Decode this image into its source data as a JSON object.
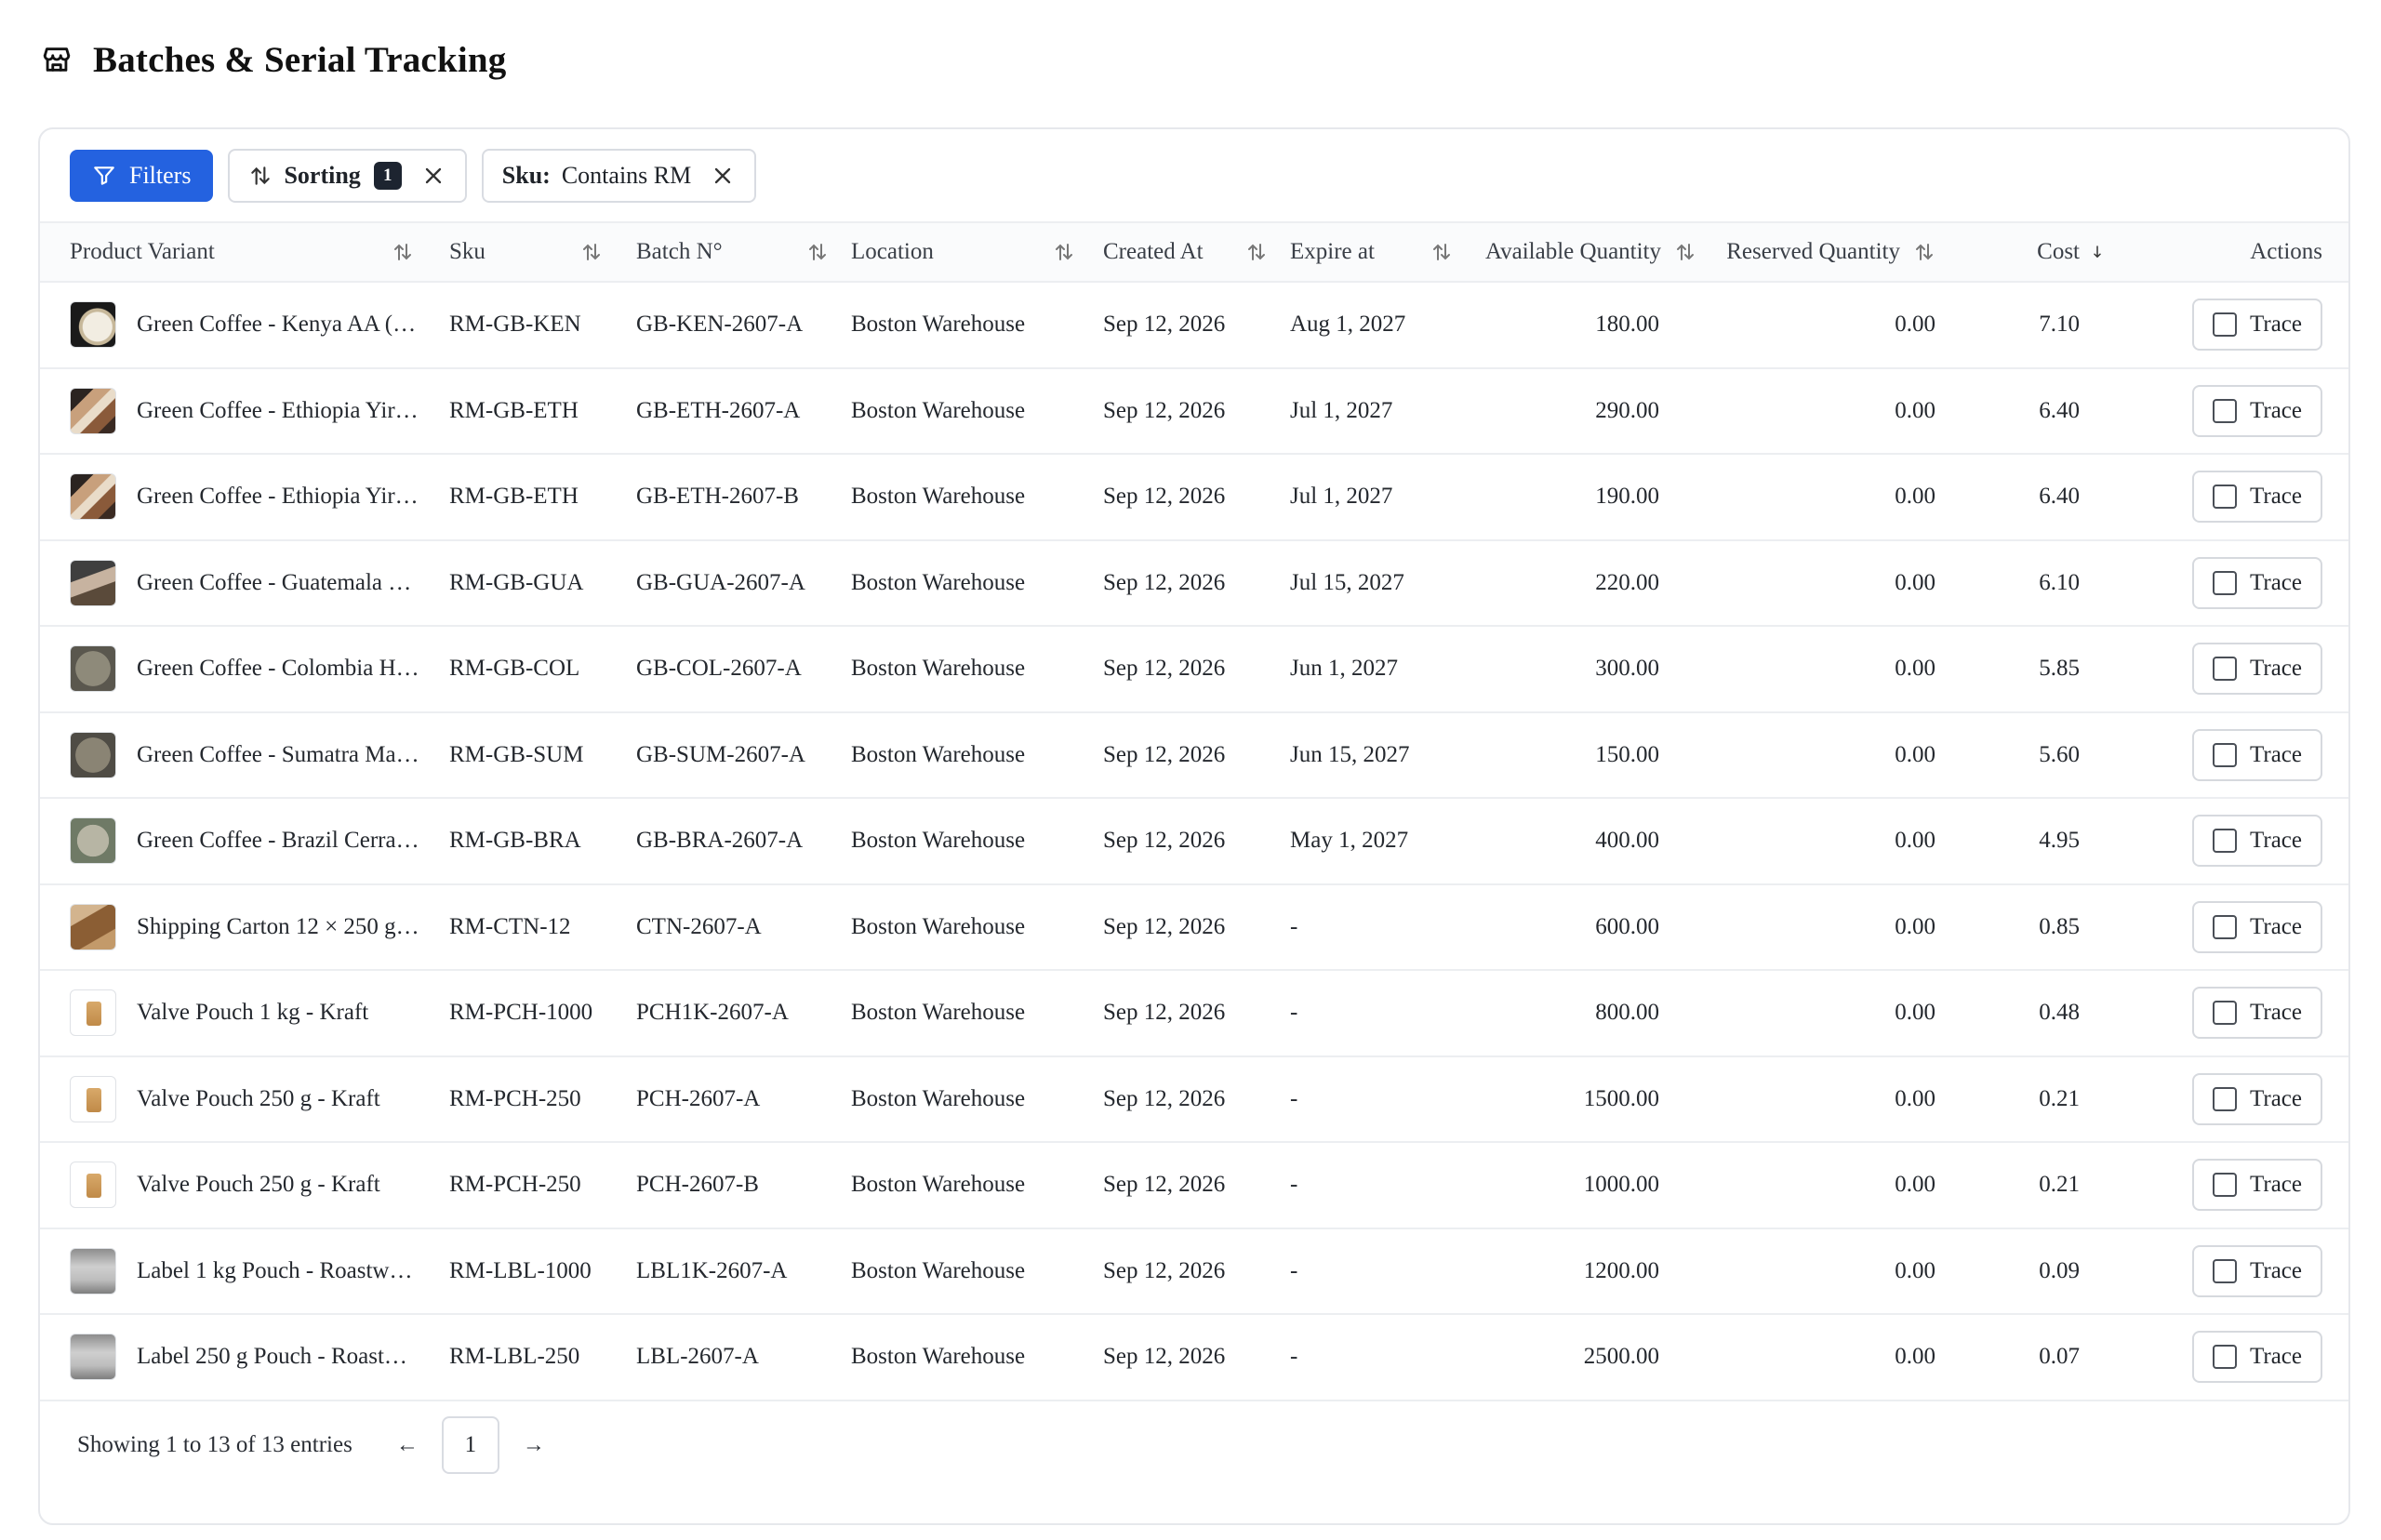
{
  "page": {
    "title": "Batches & Serial Tracking"
  },
  "toolbar": {
    "filters_label": "Filters",
    "sorting_label": "Sorting",
    "sorting_count": "1",
    "sku_chip_key": "Sku:",
    "sku_chip_value": "Contains RM"
  },
  "table": {
    "columns": [
      "Product Variant",
      "Sku",
      "Batch N°",
      "Location",
      "Created At",
      "Expire at",
      "Available Quantity",
      "Reserved Quantity",
      "Cost",
      "Actions"
    ],
    "cost_sort": "desc",
    "trace_label": "Trace",
    "rows": [
      {
        "variant": "Green Coffee - Kenya AA (…",
        "sku": "RM-GB-KEN",
        "batch": "GB-KEN-2607-A",
        "location": "Boston Warehouse",
        "created": "Sep 12, 2026",
        "expire": "Aug 1, 2027",
        "available": "180.00",
        "reserved": "0.00",
        "cost": "7.10",
        "thumb": "kenya"
      },
      {
        "variant": "Green Coffee - Ethiopia Yir…",
        "sku": "RM-GB-ETH",
        "batch": "GB-ETH-2607-A",
        "location": "Boston Warehouse",
        "created": "Sep 12, 2026",
        "expire": "Jul 1, 2027",
        "available": "290.00",
        "reserved": "0.00",
        "cost": "6.40",
        "thumb": "eth"
      },
      {
        "variant": "Green Coffee - Ethiopia Yir…",
        "sku": "RM-GB-ETH",
        "batch": "GB-ETH-2607-B",
        "location": "Boston Warehouse",
        "created": "Sep 12, 2026",
        "expire": "Jul 1, 2027",
        "available": "190.00",
        "reserved": "0.00",
        "cost": "6.40",
        "thumb": "eth"
      },
      {
        "variant": "Green Coffee - Guatemala …",
        "sku": "RM-GB-GUA",
        "batch": "GB-GUA-2607-A",
        "location": "Boston Warehouse",
        "created": "Sep 12, 2026",
        "expire": "Jul 15, 2027",
        "available": "220.00",
        "reserved": "0.00",
        "cost": "6.10",
        "thumb": "gua"
      },
      {
        "variant": "Green Coffee - Colombia H…",
        "sku": "RM-GB-COL",
        "batch": "GB-COL-2607-A",
        "location": "Boston Warehouse",
        "created": "Sep 12, 2026",
        "expire": "Jun 1, 2027",
        "available": "300.00",
        "reserved": "0.00",
        "cost": "5.85",
        "thumb": "col"
      },
      {
        "variant": "Green Coffee - Sumatra Ma…",
        "sku": "RM-GB-SUM",
        "batch": "GB-SUM-2607-A",
        "location": "Boston Warehouse",
        "created": "Sep 12, 2026",
        "expire": "Jun 15, 2027",
        "available": "150.00",
        "reserved": "0.00",
        "cost": "5.60",
        "thumb": "sum"
      },
      {
        "variant": "Green Coffee - Brazil Cerra…",
        "sku": "RM-GB-BRA",
        "batch": "GB-BRA-2607-A",
        "location": "Boston Warehouse",
        "created": "Sep 12, 2026",
        "expire": "May 1, 2027",
        "available": "400.00",
        "reserved": "0.00",
        "cost": "4.95",
        "thumb": "bra"
      },
      {
        "variant": "Shipping Carton 12 × 250 g…",
        "sku": "RM-CTN-12",
        "batch": "CTN-2607-A",
        "location": "Boston Warehouse",
        "created": "Sep 12, 2026",
        "expire": "-",
        "available": "600.00",
        "reserved": "0.00",
        "cost": "0.85",
        "thumb": "ctn"
      },
      {
        "variant": "Valve Pouch 1 kg - Kraft",
        "sku": "RM-PCH-1000",
        "batch": "PCH1K-2607-A",
        "location": "Boston Warehouse",
        "created": "Sep 12, 2026",
        "expire": "-",
        "available": "800.00",
        "reserved": "0.00",
        "cost": "0.48",
        "thumb": "pouch"
      },
      {
        "variant": "Valve Pouch 250 g - Kraft",
        "sku": "RM-PCH-250",
        "batch": "PCH-2607-A",
        "location": "Boston Warehouse",
        "created": "Sep 12, 2026",
        "expire": "-",
        "available": "1500.00",
        "reserved": "0.00",
        "cost": "0.21",
        "thumb": "pouch"
      },
      {
        "variant": "Valve Pouch 250 g - Kraft",
        "sku": "RM-PCH-250",
        "batch": "PCH-2607-B",
        "location": "Boston Warehouse",
        "created": "Sep 12, 2026",
        "expire": "-",
        "available": "1000.00",
        "reserved": "0.00",
        "cost": "0.21",
        "thumb": "pouch"
      },
      {
        "variant": "Label 1 kg Pouch - Roastw…",
        "sku": "RM-LBL-1000",
        "batch": "LBL1K-2607-A",
        "location": "Boston Warehouse",
        "created": "Sep 12, 2026",
        "expire": "-",
        "available": "1200.00",
        "reserved": "0.00",
        "cost": "0.09",
        "thumb": "lbl"
      },
      {
        "variant": "Label 250 g Pouch - Roast…",
        "sku": "RM-LBL-250",
        "batch": "LBL-2607-A",
        "location": "Boston Warehouse",
        "created": "Sep 12, 2026",
        "expire": "-",
        "available": "2500.00",
        "reserved": "0.00",
        "cost": "0.07",
        "thumb": "lbl"
      }
    ]
  },
  "footer": {
    "info": "Showing 1 to 13 of 13 entries",
    "prev": "←",
    "page": "1",
    "next": "→"
  },
  "colors": {
    "primary": "#2462e0",
    "badge": "#1d2430",
    "border": "#e6e8ec"
  },
  "icons": {
    "header": "store-icon",
    "filters": "filter-icon",
    "sorting": "sort-icon",
    "remove": "close-icon",
    "checkbox": "checkbox-icon"
  }
}
